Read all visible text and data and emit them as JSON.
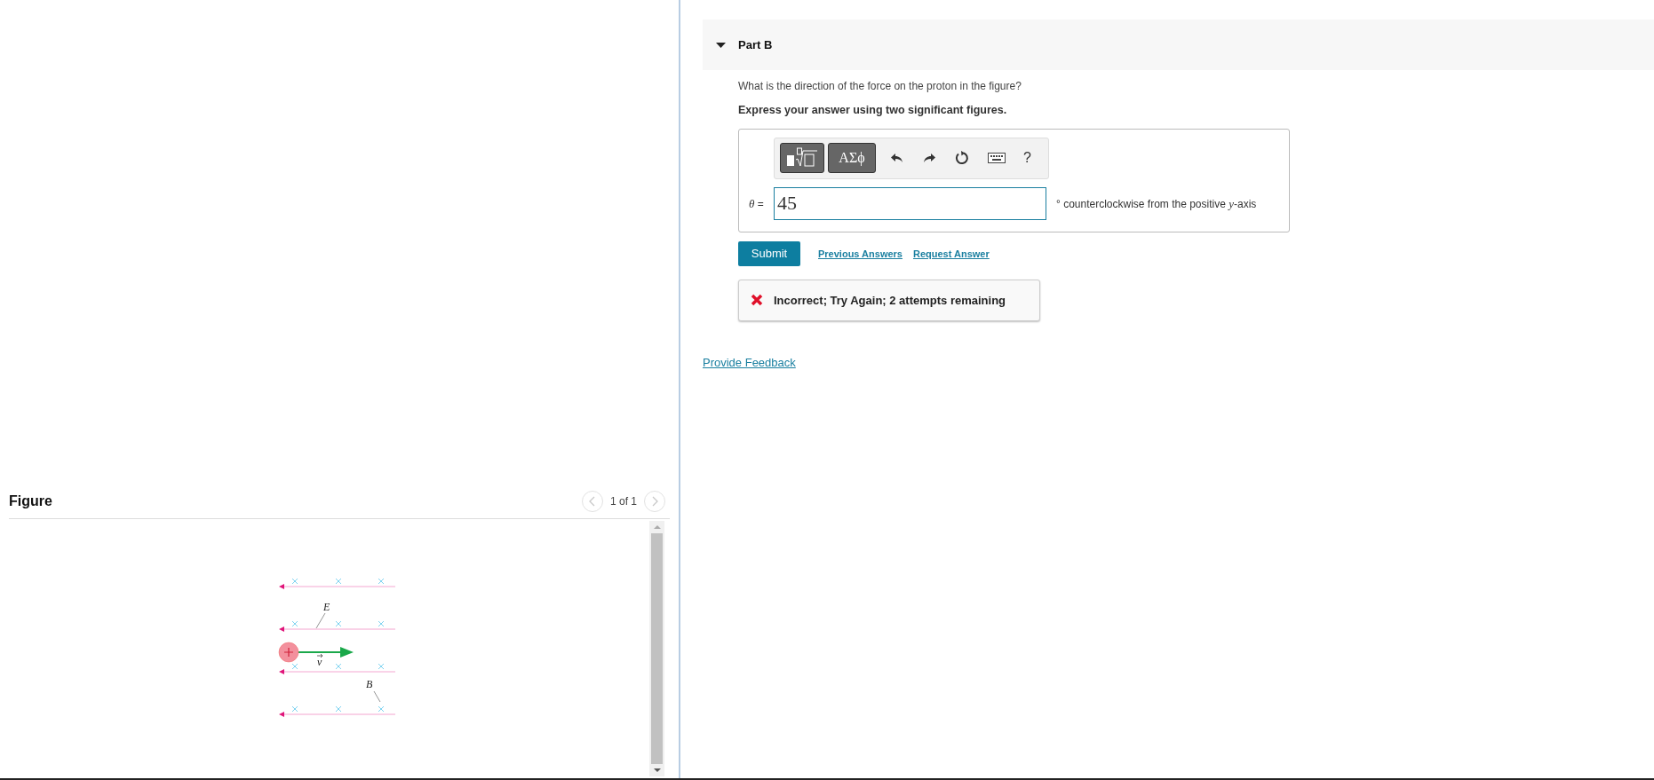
{
  "figure_panel": {
    "title": "Figure",
    "pager": {
      "text": "1 of 1",
      "prev_disabled": true,
      "next_disabled": true
    },
    "labels": [
      {
        "kind": "E",
        "text": "E"
      },
      {
        "kind": "v",
        "text": "v"
      },
      {
        "kind": "B",
        "text": "B"
      }
    ]
  },
  "part": {
    "title": "Part B",
    "expanded": true,
    "question": "What is the direction of the force on the proton in the figure?",
    "instruction": "Express your answer using two significant figures.",
    "toolbar": {
      "symbols_label": "ΑΣϕ",
      "help_label": "?"
    },
    "answer": {
      "variable": "θ",
      "equals": "=",
      "value": "45",
      "unit": "° counterclockwise from the positive ",
      "unit_var": "y",
      "unit_end": "-axis"
    },
    "submit": "Submit",
    "links": [
      "Previous Answers",
      "Request Answer"
    ],
    "feedback": {
      "kind": "incorrect",
      "text": "Incorrect; Try Again; 2 attempts remaining"
    }
  },
  "provide_feedback": "Provide Feedback"
}
